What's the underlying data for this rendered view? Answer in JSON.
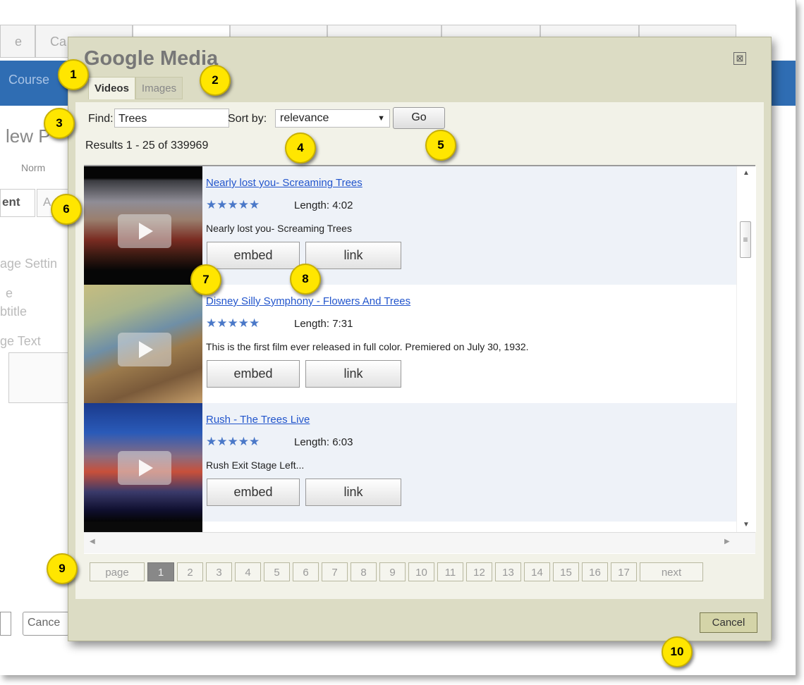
{
  "background": {
    "tabs": [
      "e",
      "Ca",
      "",
      "",
      "",
      "",
      "",
      ""
    ],
    "nav_text": "Course",
    "heading": "lew P",
    "radio_text": "Norm",
    "left_tabs": [
      "ent",
      "A"
    ],
    "fields": [
      "age Settin",
      "e",
      "btitle",
      "ge Text"
    ],
    "cancel_text": "Cance"
  },
  "dialog": {
    "title": "Google Media",
    "close_symbol": "⊠",
    "tabs": [
      {
        "label": "Videos",
        "active": true
      },
      {
        "label": "Images",
        "active": false
      }
    ],
    "find_label": "Find:",
    "find_value": "Trees",
    "sort_label": "Sort by:",
    "sort_value": "relevance",
    "go_label": "Go",
    "results_text": "Results 1 - 25 of 339969",
    "videos": [
      {
        "title": "Nearly lost you- Screaming Trees",
        "stars": "★★★★★",
        "length": "Length: 4:02",
        "description": "Nearly lost you- Screaming Trees",
        "embed_label": "embed",
        "link_label": "link"
      },
      {
        "title": "Disney Silly Symphony - Flowers And Trees",
        "stars": "★★★★★",
        "length": "Length: 7:31",
        "description": "This is the first film ever released in full color. Premiered on July 30, 1932.",
        "embed_label": "embed",
        "link_label": "link"
      },
      {
        "title": "Rush - The Trees Live",
        "stars": "★★★★★",
        "length": "Length: 6:03",
        "description": "Rush Exit Stage Left...",
        "embed_label": "embed",
        "link_label": "link"
      }
    ],
    "pager": {
      "page_label": "page",
      "current": "1",
      "pages": [
        "2",
        "3",
        "4",
        "5",
        "6",
        "7",
        "8",
        "9",
        "10",
        "11",
        "12",
        "13",
        "14",
        "15",
        "16",
        "17"
      ],
      "next_label": "next"
    },
    "cancel_label": "Cancel"
  },
  "callouts": [
    "1",
    "2",
    "3",
    "4",
    "5",
    "6",
    "7",
    "8",
    "9",
    "10"
  ],
  "colors": {
    "callout": "#ffe600",
    "dialog": "#dcdcc4",
    "link": "#2255cc"
  }
}
